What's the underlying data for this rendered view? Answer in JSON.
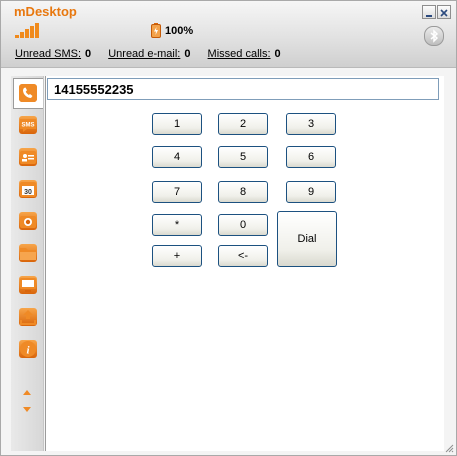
{
  "window": {
    "title": "mDesktop"
  },
  "status": {
    "battery_text": "100%",
    "unread_sms_label": "Unread SMS:",
    "unread_sms": "0",
    "unread_email_label": "Unread e-mail:",
    "unread_email": "0",
    "missed_calls_label": "Missed calls:",
    "missed_calls": "0"
  },
  "sidebar": {
    "items": [
      {
        "name": "phone",
        "label": ""
      },
      {
        "name": "sms",
        "label": "SMS"
      },
      {
        "name": "contacts",
        "label": ""
      },
      {
        "name": "calendar",
        "label": "30"
      },
      {
        "name": "camera",
        "label": ""
      },
      {
        "name": "files",
        "label": ""
      },
      {
        "name": "screen",
        "label": ""
      },
      {
        "name": "sync",
        "label": ""
      },
      {
        "name": "info",
        "label": "i"
      }
    ]
  },
  "dialer": {
    "number": "14155552235",
    "keys": [
      "1",
      "2",
      "3",
      "4",
      "5",
      "6",
      "7",
      "8",
      "9",
      "*",
      "0",
      "+",
      "<-"
    ],
    "dial_label": "Dial"
  },
  "colors": {
    "accent": "#e8780f",
    "key_border": "#1c5180",
    "input_border": "#7f9db9"
  }
}
